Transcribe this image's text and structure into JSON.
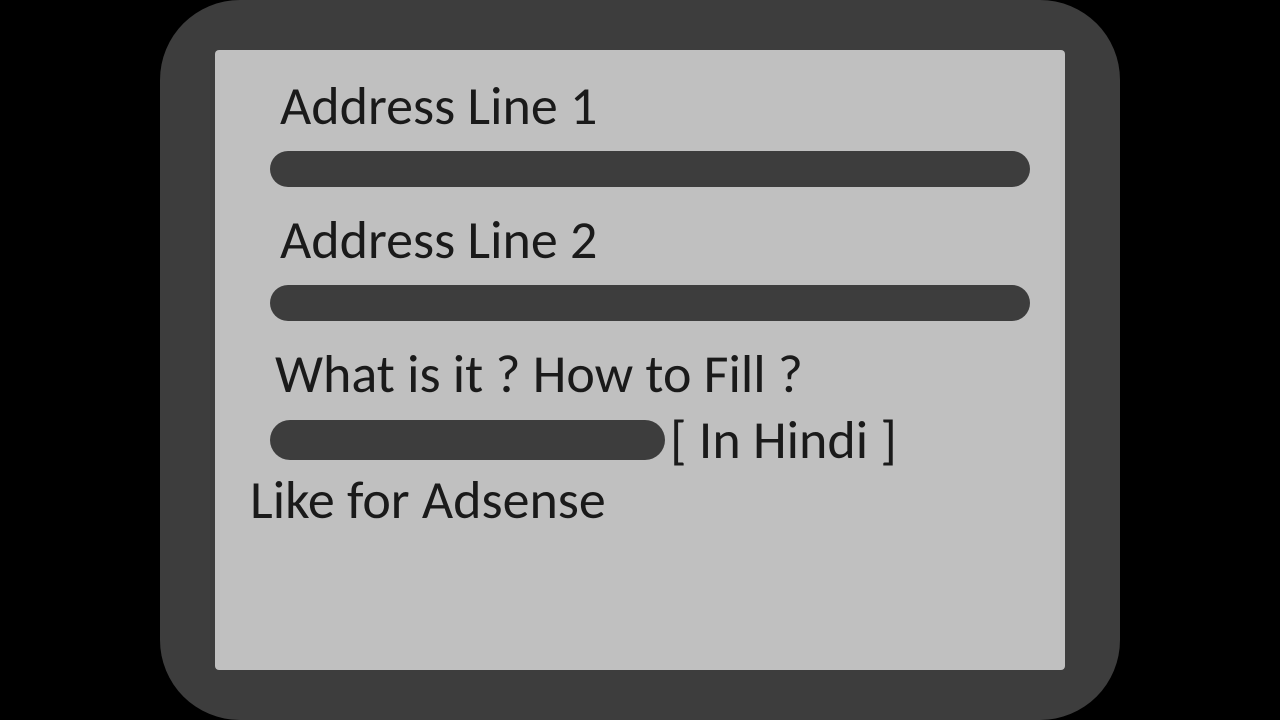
{
  "labels": {
    "addressLine1": "Address Line 1",
    "addressLine2": "Address Line 2",
    "question": "What is it ? How to Fill ?",
    "inHindi": "[ In Hindi ]",
    "footer": "Like for Adsense"
  }
}
